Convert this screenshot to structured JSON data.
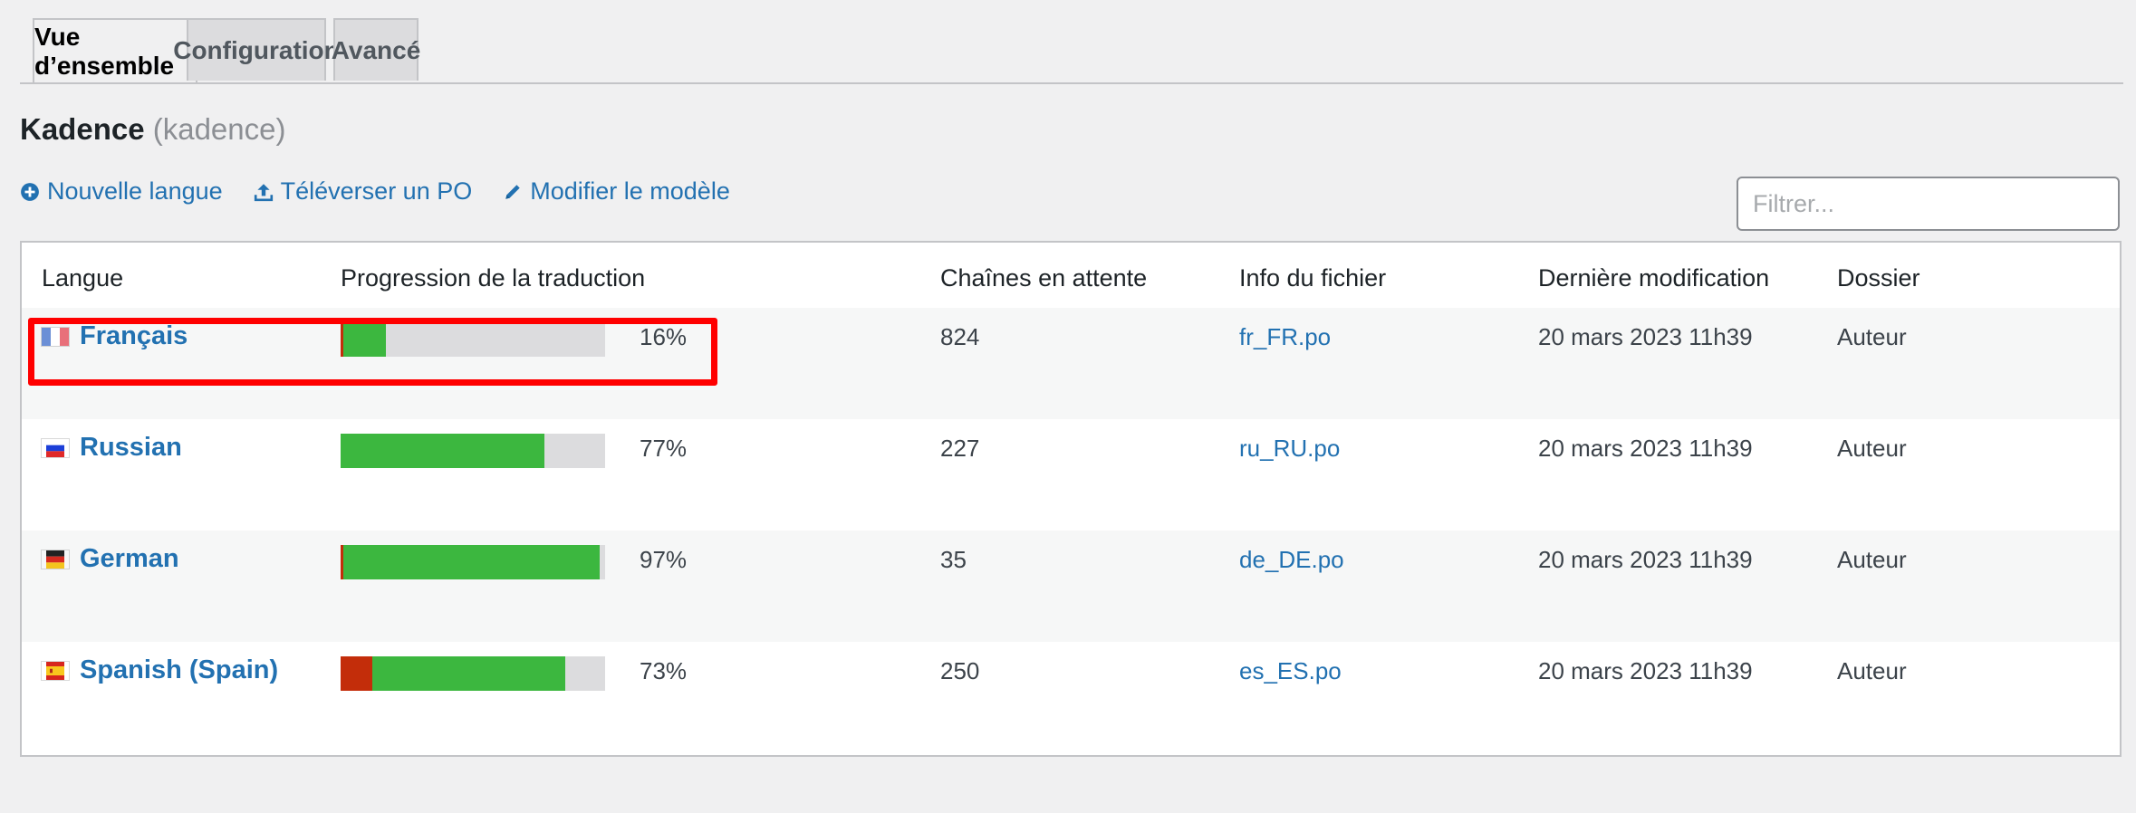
{
  "tabs": [
    {
      "label": "Vue d’ensemble",
      "active": true
    },
    {
      "label": "Configuration",
      "active": false
    },
    {
      "label": "Avancé",
      "active": false
    }
  ],
  "title": {
    "name": "Kadence",
    "slug": "(kadence)"
  },
  "actions": {
    "new_language": "Nouvelle langue",
    "upload_po": "Téléverser un PO",
    "edit_template": "Modifier le modèle"
  },
  "filter": {
    "placeholder": "Filtrer...",
    "value": ""
  },
  "table": {
    "headers": [
      "Langue",
      "Progression de la traduction",
      "Chaînes en attente",
      "Info du fichier",
      "Dernière modification",
      "Dossier"
    ],
    "rows": [
      {
        "language": "Français",
        "flag": "fr",
        "percent": "16%",
        "done": 0.16,
        "fuzzy": 0.01,
        "pending": "824",
        "file": "fr_FR.po",
        "modified": "20 mars 2023 11h39",
        "folder": "Auteur"
      },
      {
        "language": "Russian",
        "flag": "ru",
        "percent": "77%",
        "done": 0.77,
        "fuzzy": 0,
        "pending": "227",
        "file": "ru_RU.po",
        "modified": "20 mars 2023 11h39",
        "folder": "Auteur"
      },
      {
        "language": "German",
        "flag": "de",
        "percent": "97%",
        "done": 0.97,
        "fuzzy": 0.01,
        "pending": "35",
        "file": "de_DE.po",
        "modified": "20 mars 2023 11h39",
        "folder": "Auteur"
      },
      {
        "language": "Spanish (Spain)",
        "flag": "es",
        "percent": "73%",
        "done": 0.73,
        "fuzzy": 0.12,
        "pending": "250",
        "file": "es_ES.po",
        "modified": "20 mars 2023 11h39",
        "folder": "Auteur"
      }
    ]
  },
  "colors": {
    "link": "#2271b1",
    "progress_done": "#3cb73f",
    "progress_fuzzy": "#c32d0a",
    "progress_empty": "#dcdcde",
    "highlight": "#ff0000"
  }
}
